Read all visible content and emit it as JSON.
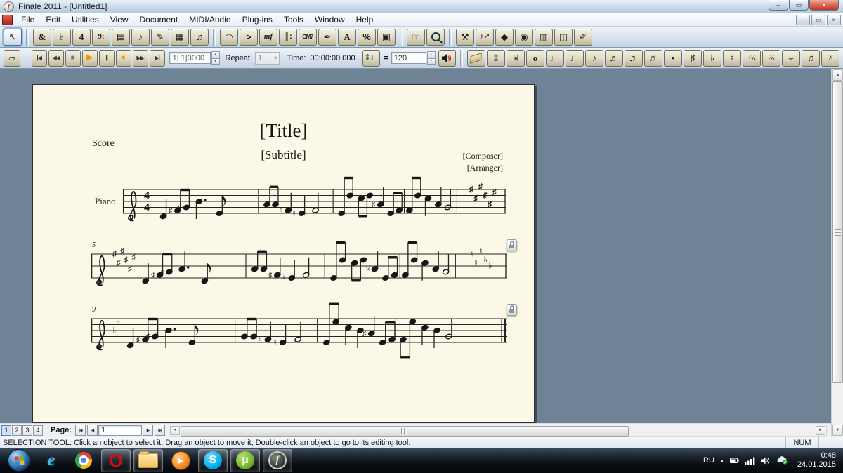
{
  "window": {
    "title": "Finale 2011 - [Untitled1]",
    "minimize_glyph": "–",
    "restore_glyph": "▭",
    "close_glyph": "×"
  },
  "menu": {
    "items": [
      "File",
      "Edit",
      "Utilities",
      "View",
      "Document",
      "MIDI/Audio",
      "Plug-ins",
      "Tools",
      "Window",
      "Help"
    ]
  },
  "main_toolbar": {
    "groups": [
      [
        {
          "name": "selection-tool",
          "glyph": "↖",
          "active": true
        }
      ],
      [
        {
          "name": "staff-tool",
          "glyph": "&",
          "cls": "serif bold"
        },
        {
          "name": "key-signature-tool",
          "glyph": "♭"
        },
        {
          "name": "time-signature-tool",
          "glyph": "4",
          "cls": "serif bold"
        },
        {
          "name": "clef-tool",
          "glyph": "9:",
          "cls": "serif bold small"
        },
        {
          "name": "measure-tool",
          "glyph": "▤"
        },
        {
          "name": "simple-entry-tool",
          "glyph": "♪"
        },
        {
          "name": "speedy-entry-tool",
          "glyph": "✎"
        },
        {
          "name": "hyperscribe-tool",
          "glyph": "▦"
        },
        {
          "name": "tuplet-tool",
          "glyph": "♫"
        }
      ],
      [
        {
          "name": "smart-shape-tool",
          "glyph": "◠"
        },
        {
          "name": "articulation-tool",
          "glyph": ">",
          "cls": "bold"
        },
        {
          "name": "expression-tool",
          "glyph": "mf",
          "cls": "serif italic bold small"
        },
        {
          "name": "repeat-tool",
          "glyph": "║:",
          "cls": "bold small"
        },
        {
          "name": "chord-tool",
          "glyph": "CM7",
          "cls": "tiny bold"
        },
        {
          "name": "lyrics-tool",
          "glyph": "✒"
        },
        {
          "name": "text-tool",
          "glyph": "A",
          "cls": "serif bold"
        },
        {
          "name": "resize-tool",
          "glyph": "%",
          "cls": "bold"
        },
        {
          "name": "page-layout-tool",
          "glyph": "▣"
        }
      ],
      [
        {
          "name": "hand-grabber-tool",
          "glyph": "☞"
        },
        {
          "name": "zoom-tool",
          "glyph": ""
        }
      ],
      [
        {
          "name": "special-tools-tool",
          "glyph": "⚒"
        },
        {
          "name": "note-mover-tool",
          "glyph": "♪↗",
          "cls": "small"
        },
        {
          "name": "graphics-tool",
          "glyph": "◆"
        },
        {
          "name": "midi-tool",
          "glyph": "◉"
        },
        {
          "name": "ossia-tool",
          "glyph": "▥"
        },
        {
          "name": "mirror-tool",
          "glyph": "◫"
        },
        {
          "name": "broom-tool",
          "glyph": "✐"
        }
      ]
    ]
  },
  "playback": {
    "page_turn_glyph": "▱",
    "transport": [
      {
        "name": "go-to-beginning",
        "glyph": "|◀"
      },
      {
        "name": "rewind",
        "glyph": "◀◀"
      },
      {
        "name": "stop",
        "glyph": "■"
      },
      {
        "name": "play",
        "glyph": "▶"
      },
      {
        "name": "pause",
        "glyph": "||"
      },
      {
        "name": "record",
        "glyph": "●"
      },
      {
        "name": "fast-forward",
        "glyph": "▶▶"
      },
      {
        "name": "go-to-end",
        "glyph": "▶|"
      }
    ],
    "counter_value": "1| 1|0000",
    "repeat_label": "Repeat:",
    "repeat_value": "1",
    "time_label": "Time:",
    "time_value": "00:00:00.000",
    "tempo_note_glyph": "⇕♩",
    "equals": "=",
    "tempo_value": "120"
  },
  "simple_entry": {
    "icons": [
      {
        "name": "eraser-tool",
        "glyph": ""
      },
      {
        "name": "reposition-tool",
        "glyph": "⇕"
      },
      {
        "name": "double-whole-note",
        "glyph": "|o|",
        "cls": "tiny serif bold"
      },
      {
        "name": "whole-note",
        "glyph": "o",
        "cls": "serif bold"
      },
      {
        "name": "half-note",
        "glyph": "♩",
        "cls": "light"
      },
      {
        "name": "quarter-note",
        "glyph": "♩"
      },
      {
        "name": "eighth-note",
        "glyph": "♪"
      },
      {
        "name": "sixteenth-note",
        "glyph": "♬"
      },
      {
        "name": "thirty-second-note",
        "glyph": "♬"
      },
      {
        "name": "sixty-fourth-note",
        "glyph": "♬"
      },
      {
        "name": "augmentation-dot",
        "glyph": "•"
      },
      {
        "name": "sharp",
        "glyph": "♯"
      },
      {
        "name": "flat",
        "glyph": "♭"
      },
      {
        "name": "natural",
        "glyph": "♮"
      },
      {
        "name": "half-step-up",
        "glyph": "+½",
        "cls": "tiny bold"
      },
      {
        "name": "half-step-down",
        "glyph": "-½",
        "cls": "tiny bold"
      },
      {
        "name": "tie",
        "glyph": "⌣"
      },
      {
        "name": "tuplet-entry",
        "glyph": "♫"
      },
      {
        "name": "grace-note",
        "glyph": "♪",
        "cls": "small"
      }
    ]
  },
  "score": {
    "part_label": "Score",
    "title": "[Title]",
    "subtitle": "[Subtitle]",
    "composer": "[Composer]",
    "arranger": "[Arranger]",
    "instrument": "Piano",
    "systems": [
      {
        "number": "",
        "key": {
          "type": "sharp",
          "count": 0,
          "glyph": "♯"
        },
        "time": [
          "4",
          "4"
        ],
        "barlines": [
          0.3,
          0.52,
          0.73,
          0.885
        ],
        "end": "single",
        "end_change": [
          [
            "♯",
            8
          ],
          [
            "♯",
            5
          ],
          [
            "♯",
            9
          ],
          [
            "♯",
            6
          ],
          [
            "♯",
            3
          ],
          [
            "♯",
            7
          ]
        ],
        "notes": [
          [
            0.02,
            -1,
            "q",
            "",
            0,
            ""
          ],
          [
            0.062,
            1,
            "b",
            "♯",
            0,
            "a"
          ],
          [
            0.088,
            2,
            "b",
            "♯",
            0,
            "a"
          ],
          [
            0.125,
            4,
            "q",
            "",
            1,
            ""
          ],
          [
            0.185,
            0,
            "e",
            "",
            0,
            ""
          ],
          [
            0.325,
            3,
            "b",
            "",
            0,
            "b"
          ],
          [
            0.35,
            3,
            "b",
            "",
            0,
            "b"
          ],
          [
            0.388,
            1,
            "q",
            "♮",
            0,
            ""
          ],
          [
            0.428,
            0,
            "q",
            "♮",
            0,
            ""
          ],
          [
            0.468,
            1,
            "h",
            "",
            0,
            ""
          ],
          [
            0.545,
            0,
            "b",
            "",
            0,
            "c"
          ],
          [
            0.57,
            6,
            "b",
            "",
            0,
            "c"
          ],
          [
            0.603,
            5,
            "b",
            "",
            0,
            "d"
          ],
          [
            0.628,
            6,
            "b",
            "",
            0,
            "d"
          ],
          [
            0.66,
            3,
            "q",
            "♯",
            0,
            ""
          ],
          [
            0.69,
            0,
            "b",
            "",
            0,
            "e"
          ],
          [
            0.715,
            1,
            "b",
            "",
            0,
            "e"
          ],
          [
            0.745,
            1,
            "b",
            "",
            0,
            "f"
          ],
          [
            0.77,
            6,
            "b",
            "",
            0,
            "f"
          ],
          [
            0.8,
            5,
            "q",
            "",
            0,
            ""
          ],
          [
            0.83,
            3,
            "q",
            "",
            0,
            ""
          ],
          [
            0.858,
            2,
            "h",
            "",
            0,
            ""
          ]
        ]
      },
      {
        "number": "5",
        "key": {
          "type": "sharp",
          "count": 6,
          "glyph": "♯"
        },
        "time": null,
        "barlines": [
          0.3,
          0.52,
          0.73,
          0.885
        ],
        "end": "single",
        "end_change": [
          [
            "♮",
            8
          ],
          [
            "♮",
            5
          ],
          [
            "♮",
            9
          ],
          [
            "♭",
            6
          ],
          [
            "♭",
            4
          ]
        ],
        "notes": [
          [
            0.02,
            -1,
            "q",
            "",
            0,
            ""
          ],
          [
            0.06,
            1,
            "b",
            "♯",
            0,
            "a"
          ],
          [
            0.086,
            2,
            "b",
            "×",
            0,
            "a"
          ],
          [
            0.122,
            3,
            "q",
            "",
            1,
            ""
          ],
          [
            0.185,
            -1,
            "e",
            "",
            0,
            ""
          ],
          [
            0.325,
            3,
            "b",
            "",
            0,
            "b"
          ],
          [
            0.35,
            3,
            "b",
            "",
            0,
            "b"
          ],
          [
            0.388,
            1,
            "q",
            "♯",
            0,
            ""
          ],
          [
            0.428,
            0,
            "q",
            "♮",
            0,
            ""
          ],
          [
            0.468,
            1,
            "h",
            "",
            0,
            ""
          ],
          [
            0.545,
            0,
            "b",
            "",
            0,
            "c"
          ],
          [
            0.57,
            6,
            "b",
            "",
            0,
            "c"
          ],
          [
            0.603,
            5,
            "b",
            "",
            0,
            "d"
          ],
          [
            0.628,
            6,
            "b",
            "",
            0,
            "d"
          ],
          [
            0.66,
            3,
            "q",
            "×",
            0,
            ""
          ],
          [
            0.69,
            0,
            "b",
            "",
            0,
            "e"
          ],
          [
            0.715,
            1,
            "b",
            "",
            0,
            "e"
          ],
          [
            0.745,
            1,
            "b",
            "",
            0,
            "f"
          ],
          [
            0.77,
            6,
            "b",
            "",
            0,
            "f"
          ],
          [
            0.8,
            5,
            "q",
            "",
            0,
            ""
          ],
          [
            0.83,
            3,
            "q",
            "",
            0,
            ""
          ],
          [
            0.858,
            2,
            "h",
            "",
            0,
            ""
          ]
        ]
      },
      {
        "number": "9",
        "key": {
          "type": "flat",
          "count": 2,
          "glyph": "♭"
        },
        "time": null,
        "barlines": [
          0.3,
          0.52,
          0.73
        ],
        "end": "final",
        "end_change": null,
        "notes": [
          [
            0.02,
            -1,
            "q",
            "",
            0,
            ""
          ],
          [
            0.06,
            1,
            "b",
            "♯",
            0,
            "a"
          ],
          [
            0.086,
            2,
            "b",
            "♯",
            0,
            "a"
          ],
          [
            0.122,
            4,
            "q",
            "",
            1,
            ""
          ],
          [
            0.185,
            0,
            "e",
            "",
            0,
            ""
          ],
          [
            0.325,
            2,
            "b",
            "",
            0,
            "b"
          ],
          [
            0.35,
            2,
            "b",
            "",
            0,
            "b"
          ],
          [
            0.388,
            1,
            "q",
            "♮",
            0,
            ""
          ],
          [
            0.428,
            0,
            "q",
            "♮",
            0,
            ""
          ],
          [
            0.468,
            1,
            "h",
            "",
            0,
            ""
          ],
          [
            0.545,
            0,
            "b",
            "",
            0,
            "c"
          ],
          [
            0.57,
            7,
            "b",
            "",
            0,
            "c"
          ],
          [
            0.603,
            5,
            "q",
            "",
            0,
            ""
          ],
          [
            0.635,
            4,
            "q",
            "",
            0,
            ""
          ],
          [
            0.665,
            3,
            "q",
            "♯",
            0,
            ""
          ],
          [
            0.695,
            0,
            "b",
            "",
            0,
            "e"
          ],
          [
            0.72,
            1,
            "b",
            "",
            0,
            "e"
          ],
          [
            0.75,
            1,
            "b",
            "",
            0,
            "f"
          ],
          [
            0.775,
            7,
            "b",
            "",
            0,
            "f"
          ],
          [
            0.808,
            5,
            "q",
            "",
            0,
            ""
          ],
          [
            0.84,
            4,
            "q",
            "",
            0,
            ""
          ],
          [
            0.872,
            2,
            "h",
            "",
            0,
            ""
          ]
        ]
      }
    ]
  },
  "page_nav": {
    "presets": [
      "1",
      "2",
      "3",
      "4"
    ],
    "label": "Page:",
    "first_glyph": "|◀",
    "prev_glyph": "◀",
    "next_glyph": "▶",
    "last_glyph": "▶|",
    "value": "1",
    "hscroll_left": "◄",
    "hscroll_right": "►",
    "vscroll_up": "▲",
    "vscroll_down": "▼"
  },
  "status_bar": {
    "message": "SELECTION TOOL: Click an object to select it; Drag an object to move it; Double-click an object to go to its editing tool.",
    "num_lock": "NUM"
  },
  "taskbar": {
    "apps": [
      {
        "name": "start-button",
        "kind": "orb",
        "boxed": false
      },
      {
        "name": "internet-explorer",
        "kind": "ie",
        "glyph": "e",
        "boxed": false
      },
      {
        "name": "chrome",
        "kind": "chrome",
        "boxed": false
      },
      {
        "name": "opera",
        "kind": "opera",
        "glyph": "O",
        "boxed": true
      },
      {
        "name": "windows-explorer",
        "kind": "folder",
        "boxed": true
      },
      {
        "name": "media-player",
        "kind": "wmp",
        "glyph": "▶",
        "boxed": false
      },
      {
        "name": "skype",
        "kind": "skype",
        "glyph": "S",
        "boxed": true
      },
      {
        "name": "utorrent",
        "kind": "utorrent",
        "glyph": "µ",
        "boxed": true
      },
      {
        "name": "finale-app",
        "kind": "finale",
        "glyph": "f",
        "boxed": true
      }
    ],
    "tray": {
      "language": "RU",
      "expand_glyph": "▴",
      "icons": [
        "battery",
        "signal",
        "volume",
        "cloud"
      ],
      "time": "0:48",
      "date": "24.01.2015"
    }
  },
  "colors": {
    "workspace": "#6e8395",
    "page": "#fbf8e7",
    "play_accent": "#f59300",
    "close_button": "#c0392b",
    "selection_highlight": "#5a92c8"
  }
}
